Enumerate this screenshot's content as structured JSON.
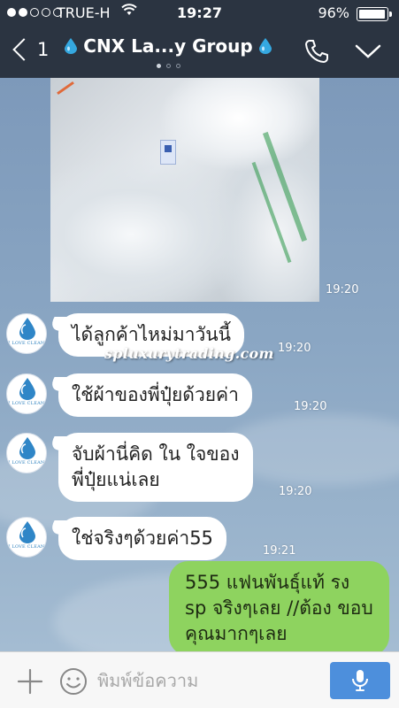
{
  "status_bar": {
    "carrier": "TRUE-H",
    "time": "19:27",
    "battery": "96%",
    "battery_level": 0.96,
    "signal_bars_filled": 2,
    "signal_bars_total": 5
  },
  "header": {
    "back_count": "1",
    "title": "CNX La...y Group",
    "page_dots": 3,
    "active_page": 0
  },
  "messages": [
    {
      "type": "image",
      "time": "19:20"
    },
    {
      "type": "text",
      "from": "them",
      "text": "ได้ลูกค้าไหม่มาวันนี้",
      "time": "19:20"
    },
    {
      "type": "text",
      "from": "them",
      "text": "ใช้ผ้าของพี่ปุ๋ยด้วยค่า",
      "time": "19:20"
    },
    {
      "type": "text",
      "from": "them",
      "text": "จับผ้านี่คิด ใน ใจของ\nพี่ปุ๋ยแน่เลย",
      "time": "19:20"
    },
    {
      "type": "text",
      "from": "them",
      "text": "ใช่จริงๆด้วยค่า55",
      "time": "19:21"
    },
    {
      "type": "text",
      "from": "me",
      "text": "555 แฟนพันธุ์แท้ รง sp จริงๆเลย //ต้อง ขอบคุณมากๆเลย"
    }
  ],
  "avatar_text": "I LOVE CLEAN",
  "watermark": "spluxurytrading.com",
  "input": {
    "placeholder": "พิมพ์ข้อความ",
    "value": ""
  },
  "colors": {
    "header_bg": "#2b3441",
    "outgoing_bubble": "#8ed35f",
    "incoming_bubble": "#ffffff",
    "mic_button": "#4d8fdc",
    "drop_icon": "#35a8e0"
  },
  "icons": [
    "back-chevron-icon",
    "water-drop-icon",
    "phone-icon",
    "chevron-down-icon",
    "plus-icon",
    "emoji-icon",
    "microphone-icon",
    "wifi-icon",
    "battery-icon"
  ]
}
